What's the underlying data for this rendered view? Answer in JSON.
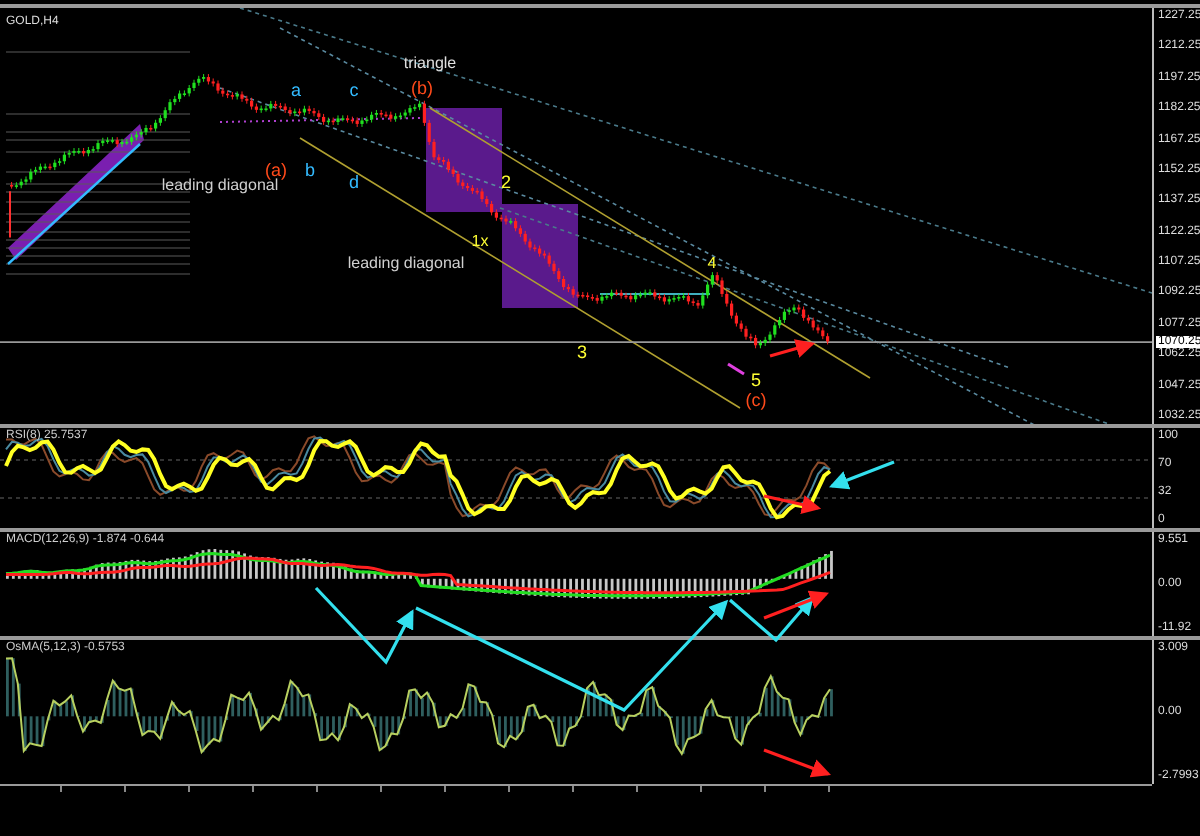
{
  "chart": {
    "symbol": "GOLD,H4",
    "price_axis": [
      "1227.25",
      "1212.25",
      "1197.25",
      "1182.25",
      "1167.25",
      "1152.25",
      "1137.25",
      "1122.25",
      "1107.25",
      "1092.25",
      "1077.25",
      "1062.25",
      "1047.25",
      "1032.25"
    ],
    "current_price": "1070.25",
    "annotations": [
      {
        "text": "triangle",
        "color": "#e0e0e0"
      },
      {
        "text": "a",
        "color": "#33bbff"
      },
      {
        "text": "c",
        "color": "#33bbff"
      },
      {
        "text": "(b)",
        "color": "#ff4a1a"
      },
      {
        "text": "leading diagonal",
        "color": "#d0d0d0"
      },
      {
        "text": "(a)",
        "color": "#ff4a1a"
      },
      {
        "text": "b",
        "color": "#33bbff"
      },
      {
        "text": "d",
        "color": "#33bbff"
      },
      {
        "text": "2",
        "color": "#ffff33"
      },
      {
        "text": "1x",
        "color": "#ffff33"
      },
      {
        "text": "leading diagonal",
        "color": "#d0d0d0"
      },
      {
        "text": "4",
        "color": "#ffff33"
      },
      {
        "text": "3",
        "color": "#ffff33"
      },
      {
        "text": "5",
        "color": "#ffff33"
      },
      {
        "text": "(c)",
        "color": "#ff4a1a"
      }
    ]
  },
  "indicators": [
    {
      "kind": "rsi",
      "title": "RSI(8) 25.7537",
      "axis": [
        "100",
        "70",
        "32",
        "0"
      ]
    },
    {
      "kind": "macd",
      "title": "MACD(12,26,9) -1.874 -0.644",
      "axis": [
        "9.551",
        "0.00",
        "-11.92"
      ]
    },
    {
      "kind": "osma",
      "title": "OsMA(5,12,3) -0.5753",
      "axis": [
        "3.009",
        "0.00",
        "-2.7993"
      ]
    }
  ]
}
